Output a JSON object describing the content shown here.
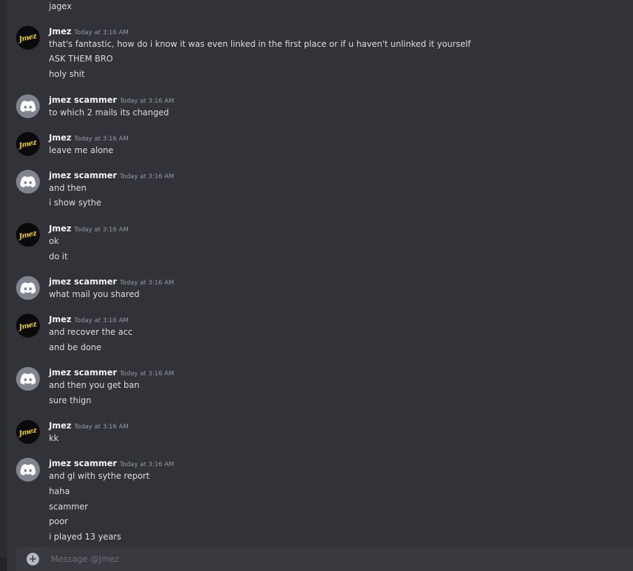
{
  "top_message": "jagex",
  "messages": [
    {
      "author": "Jmez",
      "time": "Today at 3:16 AM",
      "lines": [
        "that's fantastic, how do i know it was even linked in the first place or if u haven't unlinked it yourself",
        "ASK THEM BRO",
        "holy shit"
      ]
    },
    {
      "author": "jmez scammer",
      "time": "Today at 3:16 AM",
      "lines": [
        "to which 2 mails its changed"
      ]
    },
    {
      "author": "Jmez",
      "time": "Today at 3:16 AM",
      "lines": [
        "leave me alone"
      ]
    },
    {
      "author": "jmez scammer",
      "time": "Today at 3:16 AM",
      "lines": [
        "and then",
        "i show sythe"
      ]
    },
    {
      "author": "Jmez",
      "time": "Today at 3:16 AM",
      "lines": [
        "ok",
        "do it"
      ]
    },
    {
      "author": "jmez scammer",
      "time": "Today at 3:16 AM",
      "lines": [
        "what mail you shared"
      ]
    },
    {
      "author": "Jmez",
      "time": "Today at 3:16 AM",
      "lines": [
        "and recover the acc",
        "and be done"
      ]
    },
    {
      "author": "jmez scammer",
      "time": "Today at 3:16 AM",
      "lines": [
        "and then you get ban",
        "sure thign"
      ]
    },
    {
      "author": "Jmez",
      "time": "Today at 3:16 AM",
      "lines": [
        "kk"
      ]
    },
    {
      "author": "jmez scammer",
      "time": "Today at 3:16 AM",
      "lines": [
        "and gl with sythe report",
        "haha",
        "scammer",
        "poor",
        "i played 13 years"
      ]
    }
  ],
  "composer": {
    "placeholder": "Message @Jmez"
  },
  "icons": {
    "add": "plus-circle-icon",
    "default_avatar": "discord-logo-icon"
  },
  "colors": {
    "background": "#313338",
    "username": "#f2f3f5",
    "timestamp": "#949ba4",
    "text": "#dbdee1"
  }
}
